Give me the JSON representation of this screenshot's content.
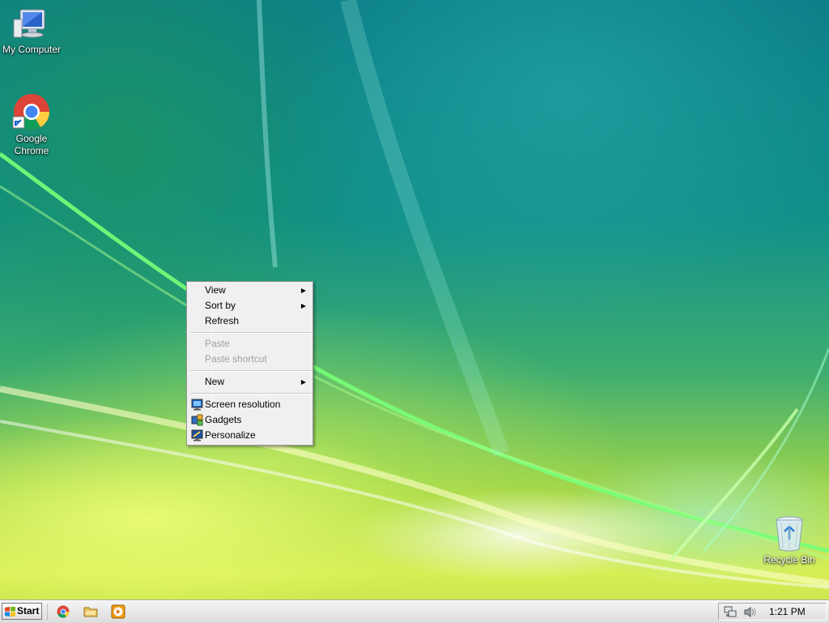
{
  "desktop": {
    "icons": [
      {
        "label": "My Computer",
        "icon": "computer-icon"
      },
      {
        "label_line1": "Google",
        "label_line2": "Chrome",
        "icon": "chrome-icon"
      },
      {
        "label": "Recycle Bin",
        "icon": "recycle-bin-icon"
      }
    ]
  },
  "context_menu": {
    "items": [
      {
        "label": "View",
        "submenu": true,
        "enabled": true
      },
      {
        "label": "Sort by",
        "submenu": true,
        "enabled": true
      },
      {
        "label": "Refresh",
        "submenu": false,
        "enabled": true
      },
      {
        "label": "Paste",
        "submenu": false,
        "enabled": false
      },
      {
        "label": "Paste shortcut",
        "submenu": false,
        "enabled": false
      },
      {
        "label": "New",
        "submenu": true,
        "enabled": true
      },
      {
        "label": "Screen resolution",
        "icon": "screen-resolution-icon",
        "enabled": true
      },
      {
        "label": "Gadgets",
        "icon": "gadgets-icon",
        "enabled": true
      },
      {
        "label": "Personalize",
        "icon": "personalize-icon",
        "enabled": true
      }
    ],
    "submenu_arrow": "▶"
  },
  "taskbar": {
    "start_label": "Start",
    "quick_launch": [
      "chrome-icon",
      "folder-icon",
      "media-player-icon"
    ],
    "tray_icons": [
      "network-icon",
      "volume-icon"
    ],
    "clock": "1:21 PM"
  },
  "colors": {
    "menu_bg": "#f0f0f0",
    "menu_border": "#979797",
    "disabled_text": "#a0a0a0"
  }
}
